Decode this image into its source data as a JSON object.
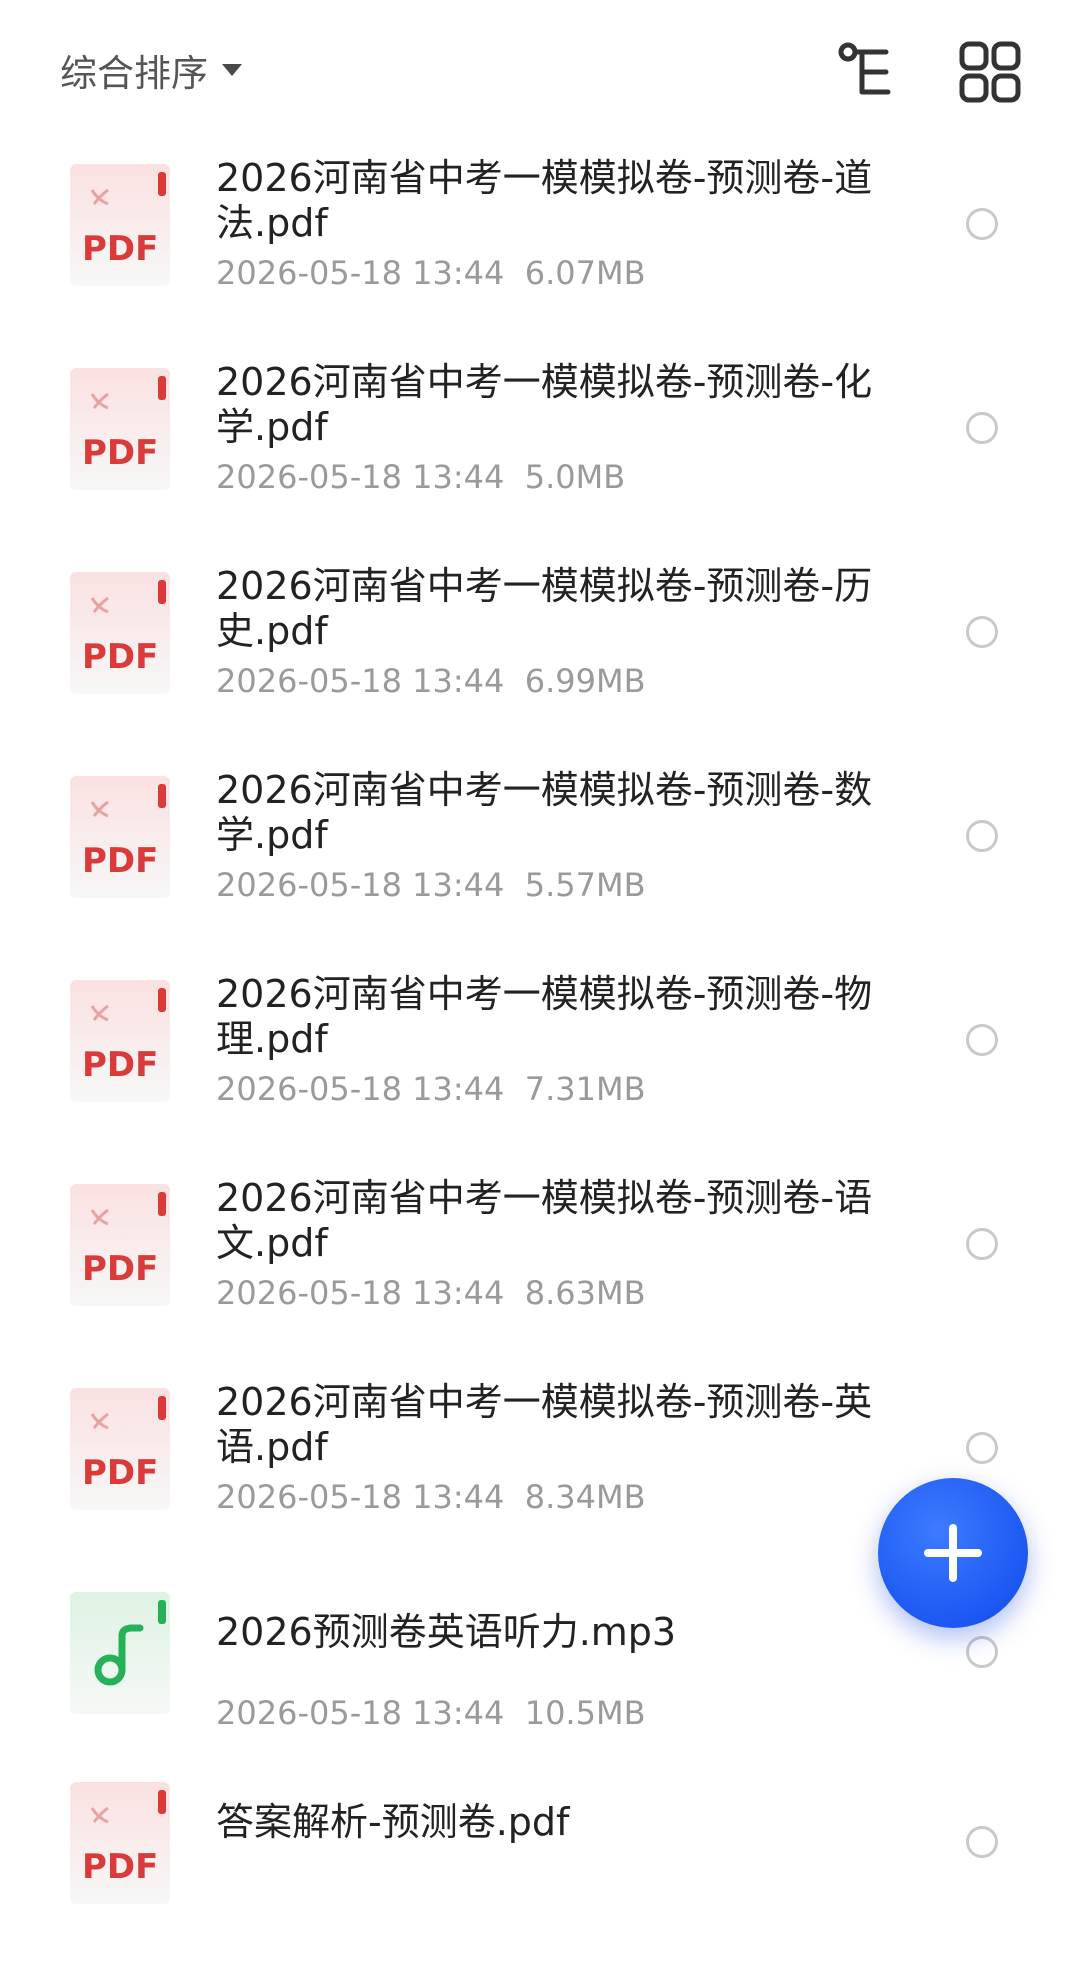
{
  "header": {
    "sort_label": "综合排序",
    "sort_caret_icon": "caret-down-icon",
    "tree_view_icon": "tree-view-icon",
    "grid_view_icon": "grid-view-icon"
  },
  "files": [
    {
      "name": "2026河南省中考一模模拟卷-预测卷-道法.pdf",
      "date": "2026-05-18 13:44",
      "size": "6.07MB",
      "type": "pdf"
    },
    {
      "name": "2026河南省中考一模模拟卷-预测卷-化学.pdf",
      "date": "2026-05-18 13:44",
      "size": "5.0MB",
      "type": "pdf"
    },
    {
      "name": "2026河南省中考一模模拟卷-预测卷-历史.pdf",
      "date": "2026-05-18 13:44",
      "size": "6.99MB",
      "type": "pdf"
    },
    {
      "name": "2026河南省中考一模模拟卷-预测卷-数学.pdf",
      "date": "2026-05-18 13:44",
      "size": "5.57MB",
      "type": "pdf"
    },
    {
      "name": "2026河南省中考一模模拟卷-预测卷-物理.pdf",
      "date": "2026-05-18 13:44",
      "size": "7.31MB",
      "type": "pdf"
    },
    {
      "name": "2026河南省中考一模模拟卷-预测卷-语文.pdf",
      "date": "2026-05-18 13:44",
      "size": "8.63MB",
      "type": "pdf"
    },
    {
      "name": "2026河南省中考一模模拟卷-预测卷-英语.pdf",
      "date": "2026-05-18 13:44",
      "size": "8.34MB",
      "type": "pdf"
    },
    {
      "name": "2026预测卷英语听力.mp3",
      "date": "2026-05-18 13:44",
      "size": "10.5MB",
      "type": "mp3"
    },
    {
      "name": "答案解析-预测卷.pdf",
      "date": "",
      "size": "",
      "type": "pdf"
    }
  ],
  "icons": {
    "pdf_label": "PDF",
    "pdf_color": "#d93a3a",
    "audio_color": "#27b05a"
  },
  "fab": {
    "icon": "plus-icon",
    "color": "#1c58f2"
  }
}
